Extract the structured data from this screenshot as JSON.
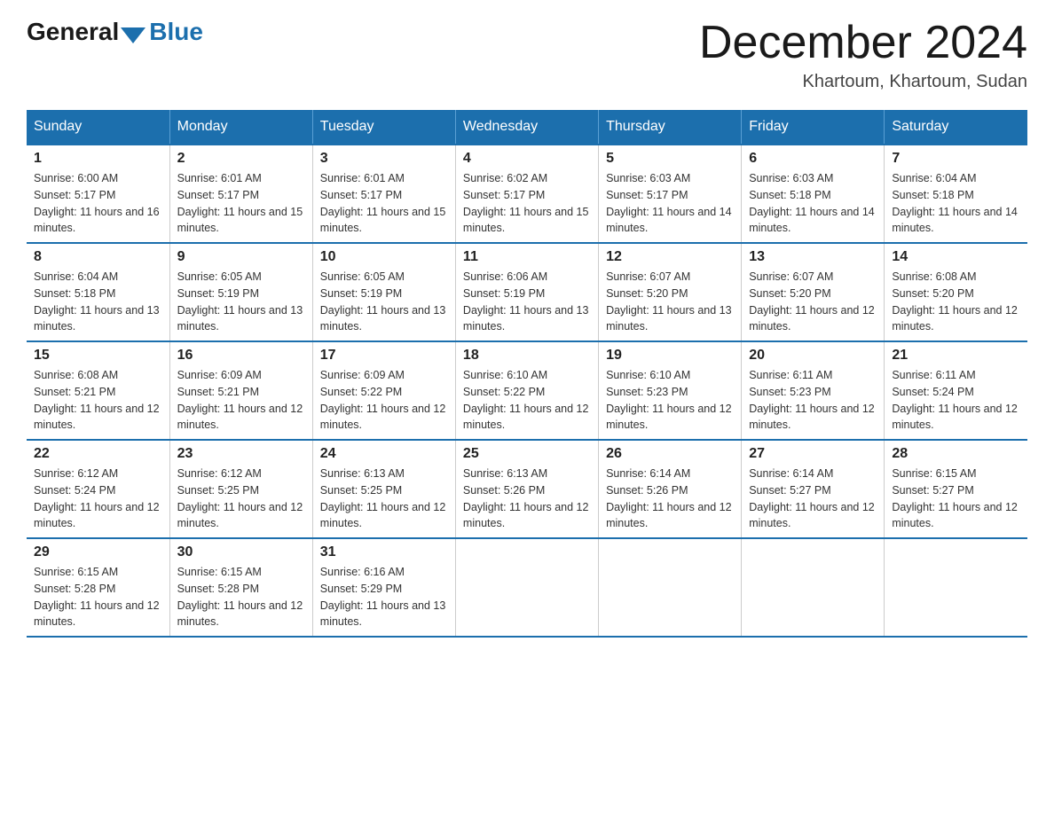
{
  "logo": {
    "general": "General",
    "blue": "Blue"
  },
  "title": "December 2024",
  "location": "Khartoum, Khartoum, Sudan",
  "days_of_week": [
    "Sunday",
    "Monday",
    "Tuesday",
    "Wednesday",
    "Thursday",
    "Friday",
    "Saturday"
  ],
  "weeks": [
    [
      {
        "day": "1",
        "sunrise": "6:00 AM",
        "sunset": "5:17 PM",
        "daylight": "11 hours and 16 minutes."
      },
      {
        "day": "2",
        "sunrise": "6:01 AM",
        "sunset": "5:17 PM",
        "daylight": "11 hours and 15 minutes."
      },
      {
        "day": "3",
        "sunrise": "6:01 AM",
        "sunset": "5:17 PM",
        "daylight": "11 hours and 15 minutes."
      },
      {
        "day": "4",
        "sunrise": "6:02 AM",
        "sunset": "5:17 PM",
        "daylight": "11 hours and 15 minutes."
      },
      {
        "day": "5",
        "sunrise": "6:03 AM",
        "sunset": "5:17 PM",
        "daylight": "11 hours and 14 minutes."
      },
      {
        "day": "6",
        "sunrise": "6:03 AM",
        "sunset": "5:18 PM",
        "daylight": "11 hours and 14 minutes."
      },
      {
        "day": "7",
        "sunrise": "6:04 AM",
        "sunset": "5:18 PM",
        "daylight": "11 hours and 14 minutes."
      }
    ],
    [
      {
        "day": "8",
        "sunrise": "6:04 AM",
        "sunset": "5:18 PM",
        "daylight": "11 hours and 13 minutes."
      },
      {
        "day": "9",
        "sunrise": "6:05 AM",
        "sunset": "5:19 PM",
        "daylight": "11 hours and 13 minutes."
      },
      {
        "day": "10",
        "sunrise": "6:05 AM",
        "sunset": "5:19 PM",
        "daylight": "11 hours and 13 minutes."
      },
      {
        "day": "11",
        "sunrise": "6:06 AM",
        "sunset": "5:19 PM",
        "daylight": "11 hours and 13 minutes."
      },
      {
        "day": "12",
        "sunrise": "6:07 AM",
        "sunset": "5:20 PM",
        "daylight": "11 hours and 13 minutes."
      },
      {
        "day": "13",
        "sunrise": "6:07 AM",
        "sunset": "5:20 PM",
        "daylight": "11 hours and 12 minutes."
      },
      {
        "day": "14",
        "sunrise": "6:08 AM",
        "sunset": "5:20 PM",
        "daylight": "11 hours and 12 minutes."
      }
    ],
    [
      {
        "day": "15",
        "sunrise": "6:08 AM",
        "sunset": "5:21 PM",
        "daylight": "11 hours and 12 minutes."
      },
      {
        "day": "16",
        "sunrise": "6:09 AM",
        "sunset": "5:21 PM",
        "daylight": "11 hours and 12 minutes."
      },
      {
        "day": "17",
        "sunrise": "6:09 AM",
        "sunset": "5:22 PM",
        "daylight": "11 hours and 12 minutes."
      },
      {
        "day": "18",
        "sunrise": "6:10 AM",
        "sunset": "5:22 PM",
        "daylight": "11 hours and 12 minutes."
      },
      {
        "day": "19",
        "sunrise": "6:10 AM",
        "sunset": "5:23 PM",
        "daylight": "11 hours and 12 minutes."
      },
      {
        "day": "20",
        "sunrise": "6:11 AM",
        "sunset": "5:23 PM",
        "daylight": "11 hours and 12 minutes."
      },
      {
        "day": "21",
        "sunrise": "6:11 AM",
        "sunset": "5:24 PM",
        "daylight": "11 hours and 12 minutes."
      }
    ],
    [
      {
        "day": "22",
        "sunrise": "6:12 AM",
        "sunset": "5:24 PM",
        "daylight": "11 hours and 12 minutes."
      },
      {
        "day": "23",
        "sunrise": "6:12 AM",
        "sunset": "5:25 PM",
        "daylight": "11 hours and 12 minutes."
      },
      {
        "day": "24",
        "sunrise": "6:13 AM",
        "sunset": "5:25 PM",
        "daylight": "11 hours and 12 minutes."
      },
      {
        "day": "25",
        "sunrise": "6:13 AM",
        "sunset": "5:26 PM",
        "daylight": "11 hours and 12 minutes."
      },
      {
        "day": "26",
        "sunrise": "6:14 AM",
        "sunset": "5:26 PM",
        "daylight": "11 hours and 12 minutes."
      },
      {
        "day": "27",
        "sunrise": "6:14 AM",
        "sunset": "5:27 PM",
        "daylight": "11 hours and 12 minutes."
      },
      {
        "day": "28",
        "sunrise": "6:15 AM",
        "sunset": "5:27 PM",
        "daylight": "11 hours and 12 minutes."
      }
    ],
    [
      {
        "day": "29",
        "sunrise": "6:15 AM",
        "sunset": "5:28 PM",
        "daylight": "11 hours and 12 minutes."
      },
      {
        "day": "30",
        "sunrise": "6:15 AM",
        "sunset": "5:28 PM",
        "daylight": "11 hours and 12 minutes."
      },
      {
        "day": "31",
        "sunrise": "6:16 AM",
        "sunset": "5:29 PM",
        "daylight": "11 hours and 13 minutes."
      },
      null,
      null,
      null,
      null
    ]
  ]
}
